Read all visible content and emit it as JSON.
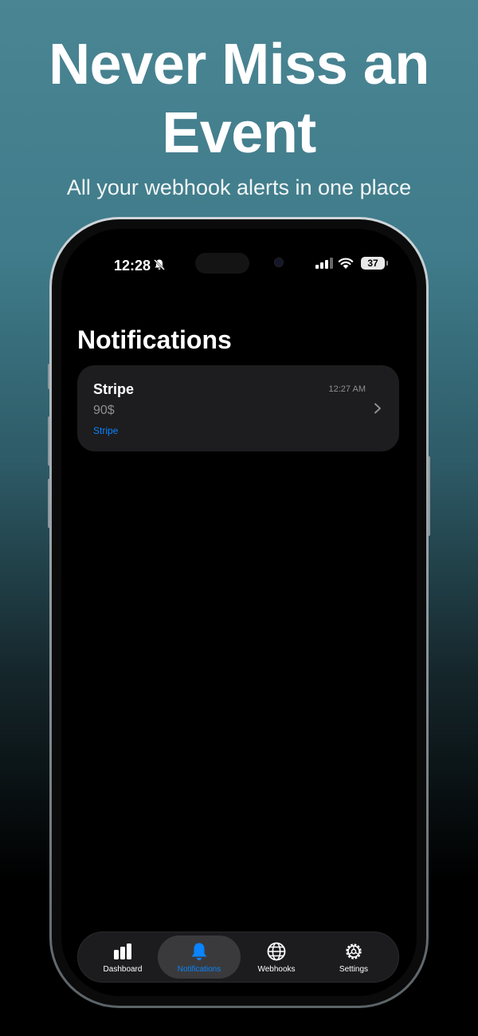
{
  "promo": {
    "headline_line1": "Never Miss an",
    "headline_line2": "Event",
    "subheadline": "All your webhook alerts in one place"
  },
  "status_bar": {
    "time": "12:28",
    "battery": "37",
    "icons": [
      "bell-slash-icon",
      "signal-icon",
      "wifi-icon",
      "battery-icon"
    ]
  },
  "screen": {
    "title": "Notifications"
  },
  "notifications": [
    {
      "title": "Stripe",
      "time": "12:27 AM",
      "amount": "90$",
      "source": "Stripe"
    }
  ],
  "tab_bar": {
    "active": "Notifications",
    "tabs": [
      {
        "label": "Dashboard",
        "icon": "bar-chart-icon"
      },
      {
        "label": "Notifications",
        "icon": "bell-icon"
      },
      {
        "label": "Webhooks",
        "icon": "globe-icon"
      },
      {
        "label": "Settings",
        "icon": "gear-icon"
      }
    ]
  },
  "colors": {
    "accent": "#0a84ff",
    "card_background": "#1d1d1f",
    "screen_background": "#000000"
  }
}
